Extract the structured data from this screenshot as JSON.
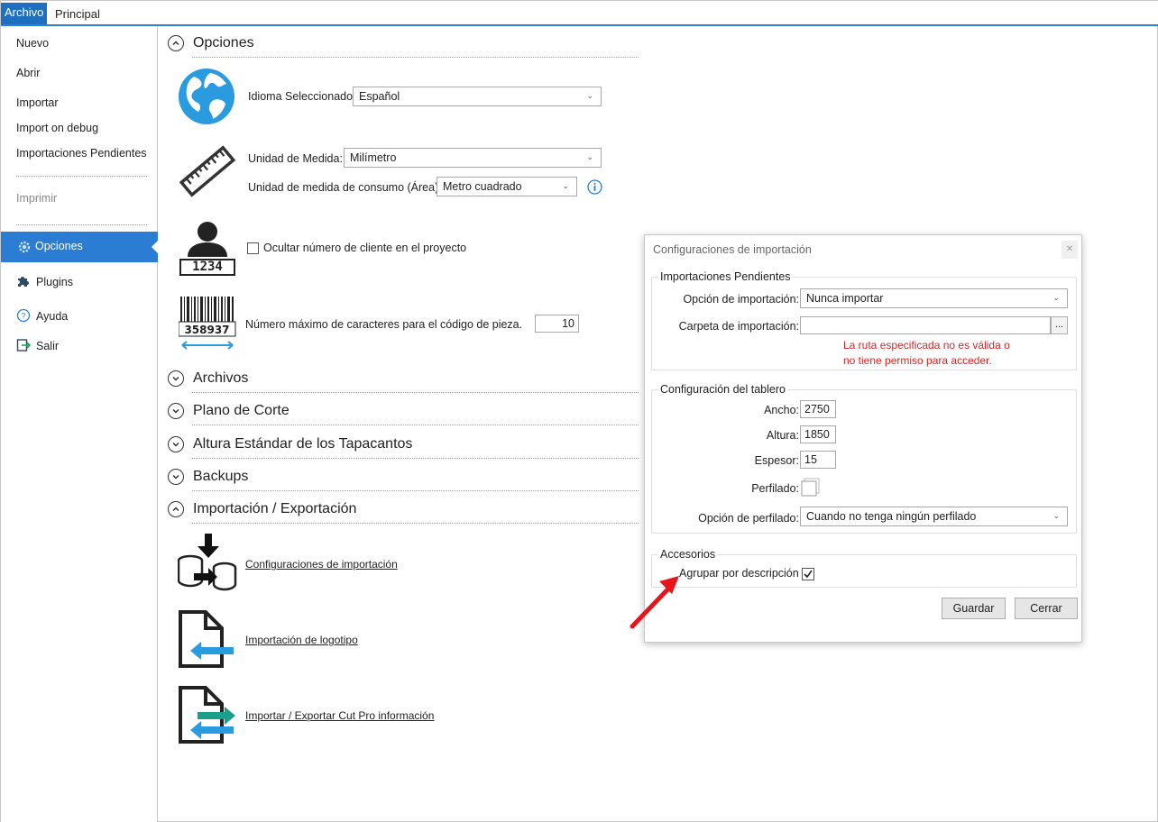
{
  "tabs": {
    "file": "Archivo",
    "main": "Principal"
  },
  "sidebar": {
    "new": "Nuevo",
    "open": "Abrir",
    "import": "Importar",
    "import_debug": "Import on debug",
    "pending": "Importaciones Pendientes",
    "print": "Imprimir",
    "options": "Opciones",
    "plugins": "Plugins",
    "help": "Ayuda",
    "exit": "Salir"
  },
  "options": {
    "title": "Opciones",
    "language_label": "Idioma Seleccionado:",
    "language_value": "Español",
    "unit_label": "Unidad de Medida:",
    "unit_value": "Milímetro",
    "area_label": "Unidad de medida de consumo (Área):",
    "area_value": "Metro cuadrado",
    "client_number": "1234",
    "hide_client_label": "Ocultar número de cliente en el proyecto",
    "barcode_number": "358937",
    "max_chars_label": "Número máximo de caracteres para el código de pieza.",
    "max_chars_value": "10"
  },
  "sections": {
    "files": "Archivos",
    "cut_plan": "Plano de Corte",
    "edge_height": "Altura Estándar de los Tapacantos",
    "backups": "Backups",
    "import_export": "Importación / Exportación"
  },
  "import_export": {
    "import_config": "Configuraciones de importación",
    "logo_import": "Importación de logotipo",
    "cutpro": "Importar / Exportar Cut Pro información"
  },
  "dialog": {
    "title": "Configuraciones de importación",
    "pending_group": "Importaciones Pendientes",
    "import_option_label": "Opción de importación:",
    "import_option_value": "Nunca importar",
    "import_folder_label": "Carpeta de importación:",
    "import_folder_value": "",
    "browse": "...",
    "error_line1": "La ruta especificada no es válida o",
    "error_line2": "no tiene permiso para acceder.",
    "board_group": "Configuración del tablero",
    "width_label": "Ancho:",
    "width_value": "2750",
    "height_label": "Altura:",
    "height_value": "1850",
    "thickness_label": "Espesor:",
    "thickness_value": "15",
    "profiled_label": "Perfilado:",
    "profile_option_label": "Opción de perfilado:",
    "profile_option_value": "Cuando no tenga ningún perfilado",
    "accessories_group": "Accesorios",
    "group_by_label": "Agrupar por descripción",
    "save": "Guardar",
    "close": "Cerrar"
  },
  "colors": {
    "accent": "#2b7dd3",
    "error": "#e02020",
    "annotation": "#e8141c"
  }
}
